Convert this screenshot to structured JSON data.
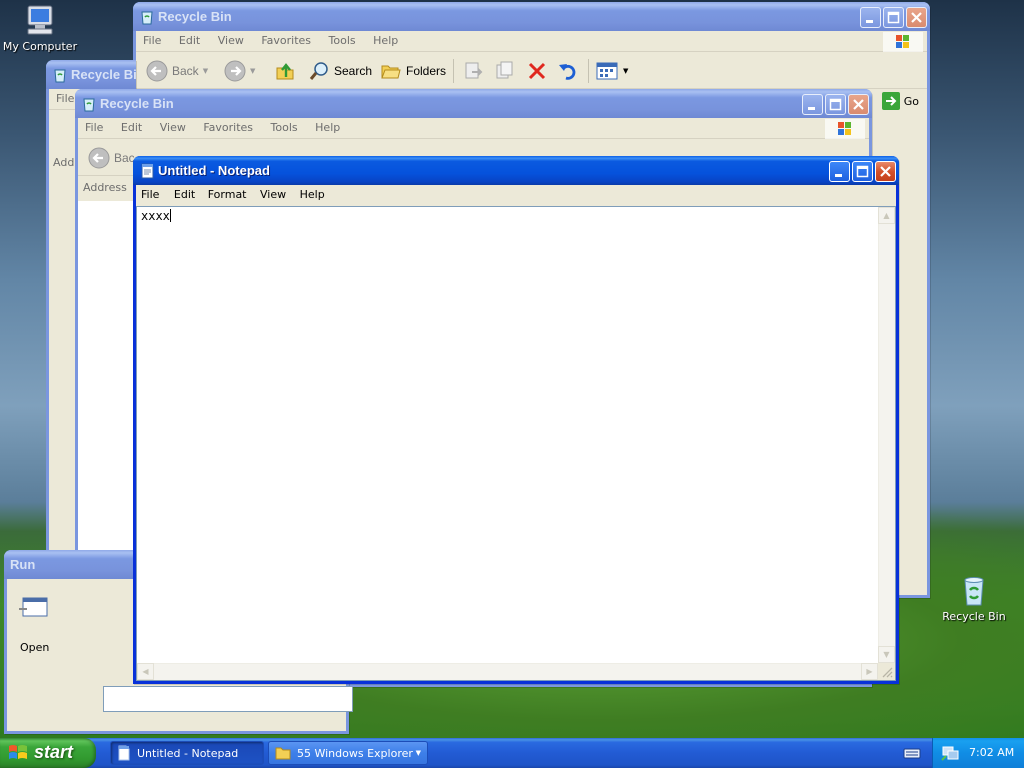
{
  "desktop": {
    "icons": [
      {
        "label": "My Computer"
      },
      {
        "label": "Recycle Bin"
      }
    ]
  },
  "recycle_back": {
    "title": "Recycle Bin",
    "menu": [
      "File",
      "Edit",
      "View",
      "Favorites",
      "Tools",
      "Help"
    ],
    "toolbar": {
      "back": "Back",
      "search": "Search",
      "folders": "Folders"
    },
    "go_label": "Go"
  },
  "recycle_left": {
    "title": "Recycle Bi",
    "menu_file": "File",
    "address_partial": "Add"
  },
  "recycle_mid": {
    "title": "Recycle Bin",
    "menu": [
      "File",
      "Edit",
      "View",
      "Favorites",
      "Tools",
      "Help"
    ],
    "back_partial": "Bac",
    "address_label": "Address"
  },
  "run": {
    "title": "Run",
    "open_label": "Open"
  },
  "notepad": {
    "title": "Untitled - Notepad",
    "menu": [
      "File",
      "Edit",
      "Format",
      "View",
      "Help"
    ],
    "content": "xxxx"
  },
  "taskbar": {
    "start": "start",
    "items": [
      {
        "label": "Untitled - Notepad"
      },
      {
        "label": "55 Windows Explorer"
      }
    ],
    "clock": "7:02 AM"
  },
  "colors": {
    "title_active": "#0552dc",
    "title_inactive": "#7893dc",
    "start_green": "#3aa63a"
  }
}
